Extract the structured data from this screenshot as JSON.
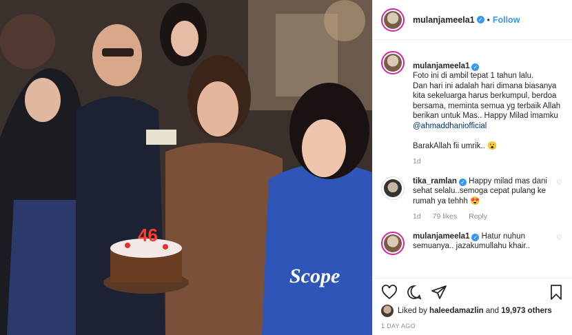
{
  "post": {
    "username": "mulanjameela1",
    "follow_label": "Follow",
    "separator": "•"
  },
  "caption": {
    "username": "mulanjameela1",
    "text_before": "Foto ini di ambil tepat 1 tahun lalu.\nDan hari ini adalah hari dimana biasanya kita sekeluarga harus berkumpul, berdoa bersama, meminta semua yg terbaik Allah berikan untuk Mas.. Happy Milad imamku ",
    "mention": "@ahmaddhaniofficial",
    "text_after": "BarakAllah fii umrik.. 😮",
    "time": "1d"
  },
  "comments": [
    {
      "username": "tika_ramlan",
      "text": "Happy milad mas dani sehat selalu..semoga cepat pulang ke rumah ya tehhh 😍",
      "time": "1d",
      "likes": "79 likes",
      "reply": "Reply"
    },
    {
      "username": "mulanjameela1",
      "text": "Hatur nuhun semuanya.. jazakumullahu khair.."
    }
  ],
  "actions": {
    "liked_by_prefix": "Liked by ",
    "liked_by_user": "haleedamazlin",
    "liked_by_middle": " and ",
    "liked_by_count": "19,973 others",
    "posted_ago": "1 DAY AGO"
  },
  "photo": {
    "cake_number": "46",
    "shirt_text": "Scope"
  },
  "icons": [
    "heart-icon",
    "comment-icon",
    "share-icon",
    "bookmark-icon"
  ],
  "colors": {
    "accent": "#3897f0",
    "verified": "#3897f0",
    "muted": "#8e8e8e"
  }
}
